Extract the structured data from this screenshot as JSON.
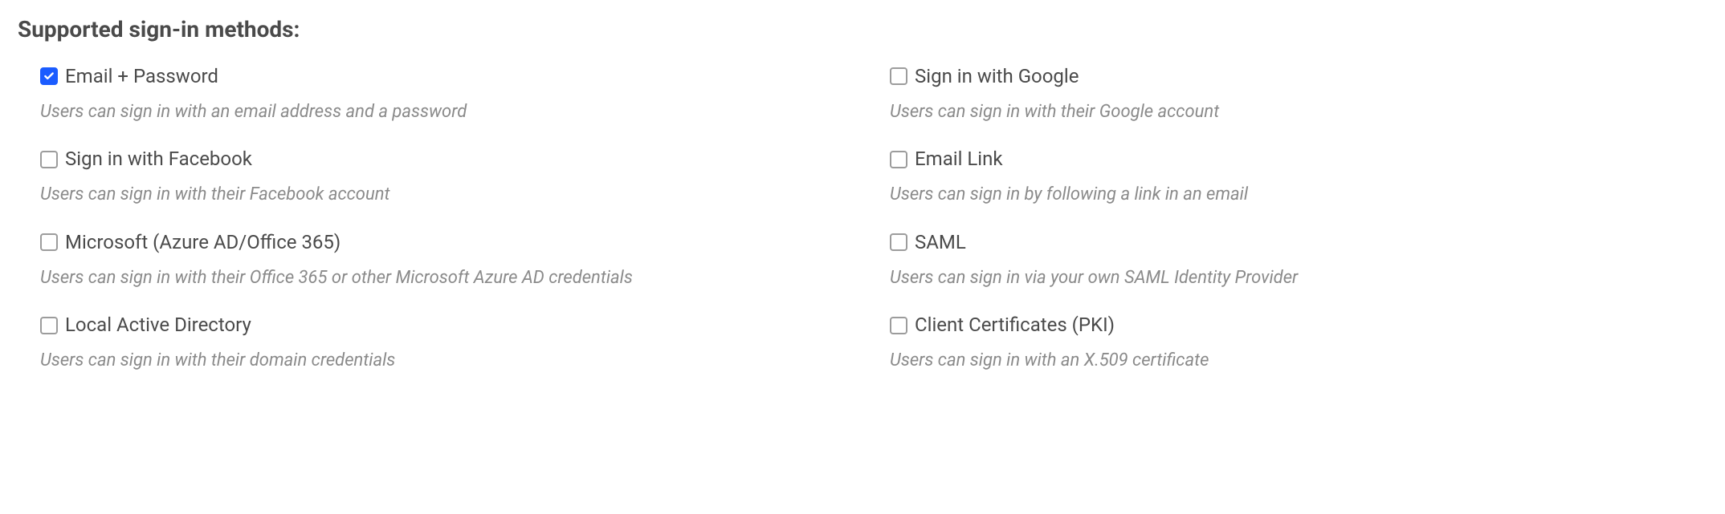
{
  "section_title": "Supported sign-in methods:",
  "methods": {
    "email_password": {
      "label": "Email + Password",
      "description": "Users can sign in with an email address and a password",
      "checked": true
    },
    "google": {
      "label": "Sign in with Google",
      "description": "Users can sign in with their Google account",
      "checked": false
    },
    "facebook": {
      "label": "Sign in with Facebook",
      "description": "Users can sign in with their Facebook account",
      "checked": false
    },
    "email_link": {
      "label": "Email Link",
      "description": "Users can sign in by following a link in an email",
      "checked": false
    },
    "microsoft": {
      "label": "Microsoft (Azure AD/Office 365)",
      "description": "Users can sign in with their Office 365 or other Microsoft Azure AD credentials",
      "checked": false
    },
    "saml": {
      "label": "SAML",
      "description": "Users can sign in via your own SAML Identity Provider",
      "checked": false
    },
    "local_ad": {
      "label": "Local Active Directory",
      "description": "Users can sign in with their domain credentials",
      "checked": false
    },
    "client_certs": {
      "label": "Client Certificates (PKI)",
      "description": "Users can sign in with an X.509 certificate",
      "checked": false
    }
  }
}
